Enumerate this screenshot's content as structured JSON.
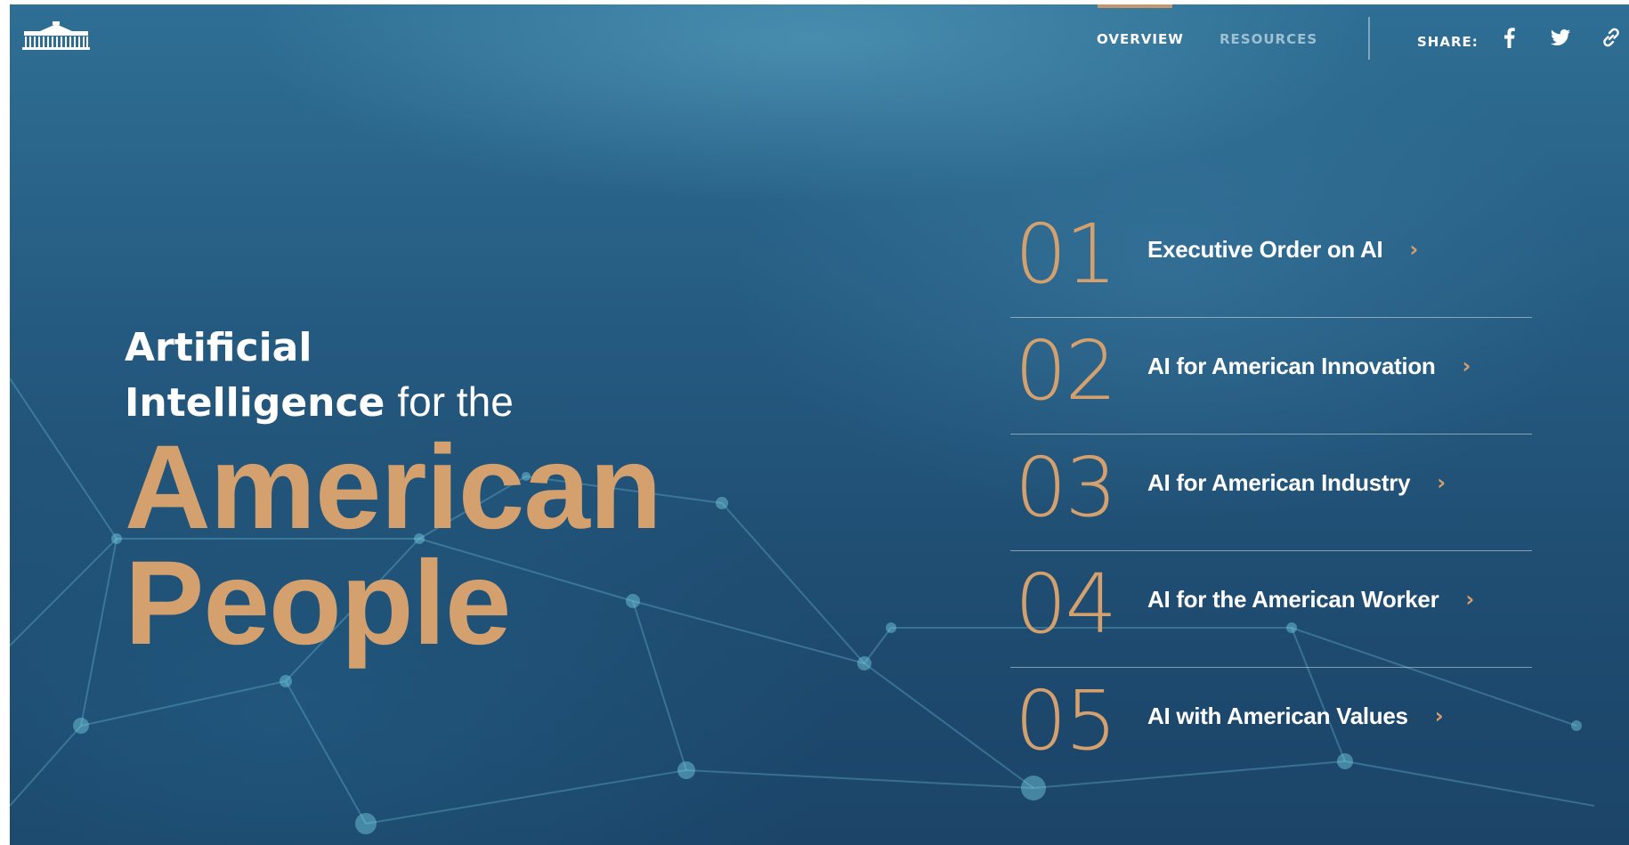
{
  "nav": {
    "overview_label": "OVERVIEW",
    "resources_label": "RESOURCES",
    "share_label": "SHARE:",
    "active_color": "#c8966b"
  },
  "share_icons": [
    "facebook-icon",
    "twitter-icon",
    "link-icon"
  ],
  "hero": {
    "line1": "Artificial",
    "line2_bold": "Intelligence",
    "line2_light": "for the",
    "line3": "American",
    "line4": "People",
    "accent_color": "#d4a06e"
  },
  "menu": {
    "items": [
      {
        "num": "01",
        "label": "Executive Order on AI"
      },
      {
        "num": "02",
        "label": "AI for American Innovation"
      },
      {
        "num": "03",
        "label": "AI for American Industry"
      },
      {
        "num": "04",
        "label": "AI for the American Worker"
      },
      {
        "num": "05",
        "label": "AI with American Values"
      }
    ]
  }
}
